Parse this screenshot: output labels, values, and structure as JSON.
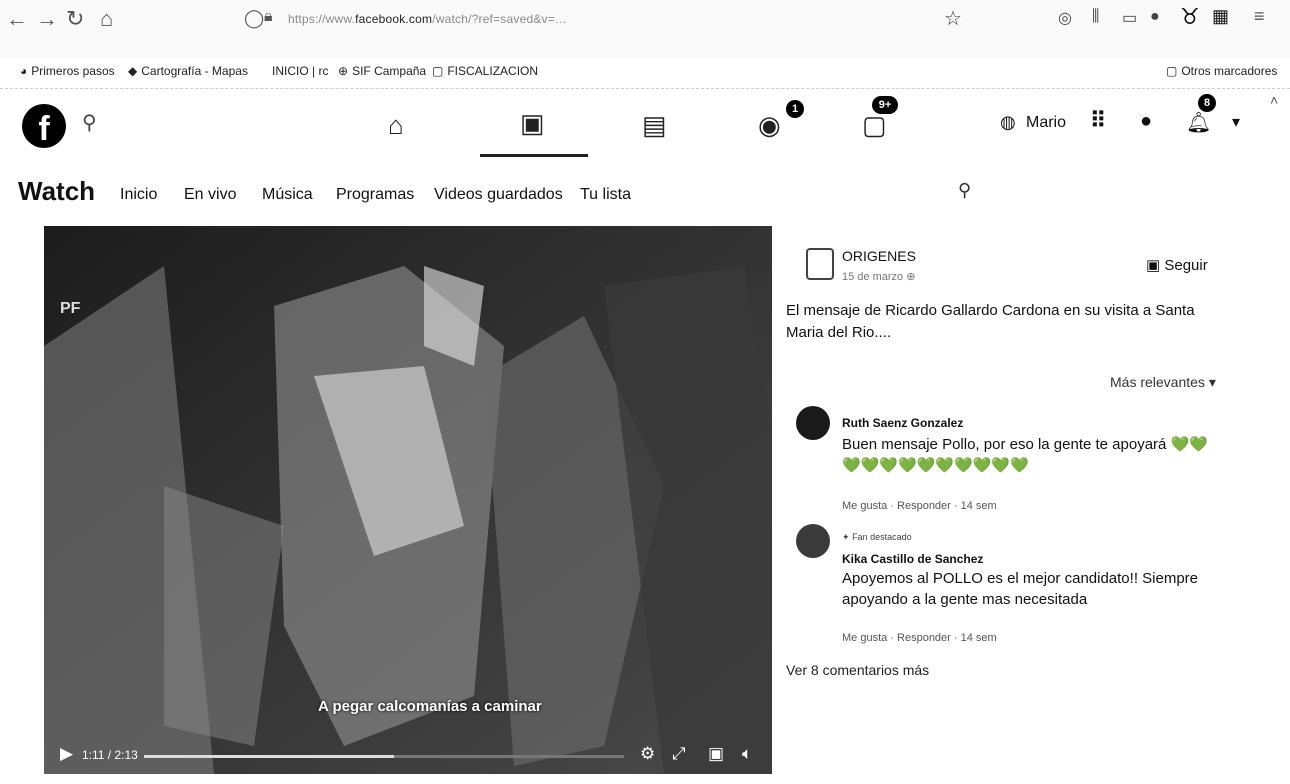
{
  "browser": {
    "url_prefix": "https://www.",
    "url_domain": "facebook.com",
    "url_rest": "/watch/?ref=saved&v=…",
    "bookmarks": [
      "Primeros pasos",
      "Cartografía - Mapas",
      "INICIO | rc",
      "SIF Campaña",
      "FISCALIZACION"
    ],
    "other_bookmarks": "Otros marcadores"
  },
  "header": {
    "user_name": "Mario",
    "badges": {
      "groups": "1",
      "pages": "9+",
      "notifications": "8"
    }
  },
  "watch": {
    "title": "Watch",
    "tabs": [
      "Inicio",
      "En vivo",
      "Música",
      "Programas",
      "Videos guardados",
      "Tu lista"
    ]
  },
  "video": {
    "caption": "A pegar calcomanías a caminar",
    "watermark": "PF",
    "time": "1:11 / 2:13",
    "progress": 0.52
  },
  "post": {
    "page_name": "ORIGENES",
    "date": "15 de marzo",
    "follow_label": "Seguir",
    "text": "El mensaje de Ricardo Gallardo Cardona en su visita a Santa Maria del Rio....",
    "sort_label": "Más relevantes ▾"
  },
  "comments": [
    {
      "name": "Ruth Saenz Gonzalez",
      "badge": "",
      "text": "Buen mensaje Pollo, por eso la gente te apoyará 💚💚 💚💚💚💚💚💚💚💚💚💚",
      "meta": "Me gusta · Responder · 14 sem"
    },
    {
      "name": "Kika Castillo de Sanchez",
      "badge": "Fan destacado",
      "text": "Apoyemos al POLLO es el mejor candidato!! Siempre apoyando a la gente mas necesitada",
      "meta": "Me gusta · Responder · 14 sem"
    }
  ],
  "more_comments": "Ver 8 comentarios más"
}
